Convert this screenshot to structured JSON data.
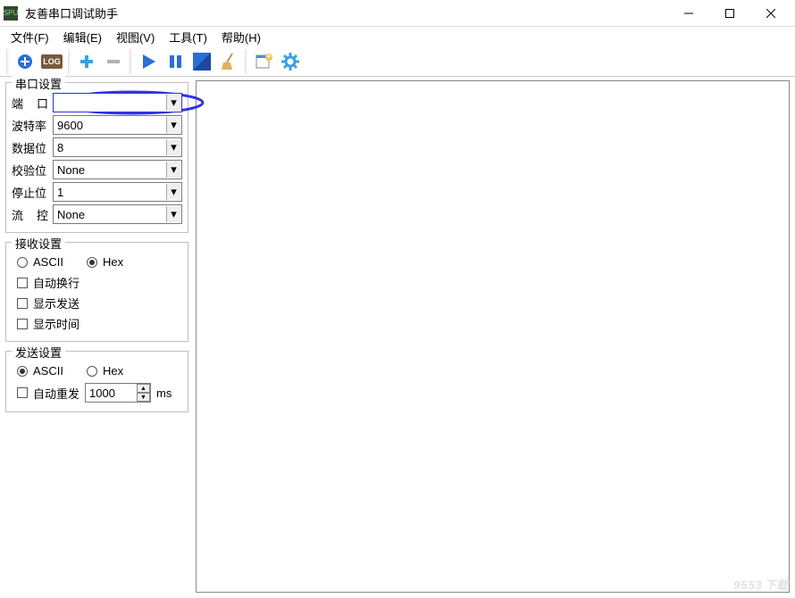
{
  "window": {
    "title": "友善串口调试助手",
    "app_icon_label": "SPU"
  },
  "menus": {
    "file": "文件(F)",
    "edit": "编辑(E)",
    "view": "视图(V)",
    "tools": "工具(T)",
    "help": "帮助(H)"
  },
  "toolbar_icons": {
    "add_port": "add-port-icon",
    "log": "LOG",
    "plus": "plus-icon",
    "minus": "minus-icon",
    "play": "play-icon",
    "pause": "pause-icon",
    "window": "window-icon",
    "broom": "broom-icon",
    "new_win": "new-window-icon",
    "gear": "gear-icon"
  },
  "serial": {
    "legend": "串口设置",
    "port_label": "端　口",
    "port_value": "",
    "baud_label": "波特率",
    "baud_value": "9600",
    "databits_label": "数据位",
    "databits_value": "8",
    "parity_label": "校验位",
    "parity_value": "None",
    "stopbits_label": "停止位",
    "stopbits_value": "1",
    "flow_label": "流　控",
    "flow_value": "None"
  },
  "recv": {
    "legend": "接收设置",
    "ascii": "ASCII",
    "hex": "Hex",
    "autowrap": "自动换行",
    "showsend": "显示发送",
    "showtime": "显示时间"
  },
  "send": {
    "legend": "发送设置",
    "ascii": "ASCII",
    "hex": "Hex",
    "autorepeat": "自动重发",
    "interval": "1000",
    "unit": "ms"
  },
  "watermark": {
    "main": "9553",
    "tld": "下载"
  }
}
